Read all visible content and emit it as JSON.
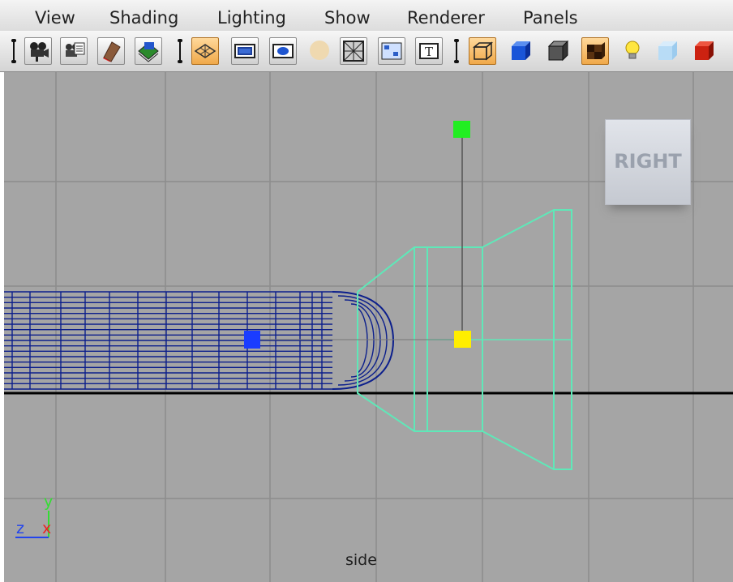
{
  "menu": {
    "view": "View",
    "shading": "Shading",
    "lighting": "Lighting",
    "show": "Show",
    "renderer": "Renderer",
    "panels": "Panels"
  },
  "toolbar": {
    "icons": [
      "select-camera-icon",
      "camera-attributes-icon",
      "bookmarks-icon",
      "image-plane-icon",
      "grid-icon",
      "film-gate-icon",
      "resolution-gate-icon",
      "safe-action-icon",
      "wireframe-on-shaded-icon",
      "isolate-icon",
      "texture-icon",
      "wireframe-icon",
      "smooth-shade-icon",
      "flat-shade-icon",
      "textured-icon",
      "lights-icon",
      "xray-icon",
      "shadows-icon"
    ],
    "active": [
      "grid-icon",
      "wireframe-icon",
      "textured-icon"
    ]
  },
  "viewport": {
    "view_cube_label": "RIGHT",
    "view_name": "side",
    "axis": {
      "y": "y",
      "z": "z",
      "x": "x"
    },
    "colors": {
      "background": "#a5a5a5",
      "grid": "#8c8c8c",
      "selected_wireframe": "#5fe8b8",
      "mesh_wireframe": "#0c1f8c",
      "pivot_blue": "#1a3cff",
      "pivot_yellow": "#ffee00",
      "pivot_green": "#22ee22"
    }
  }
}
